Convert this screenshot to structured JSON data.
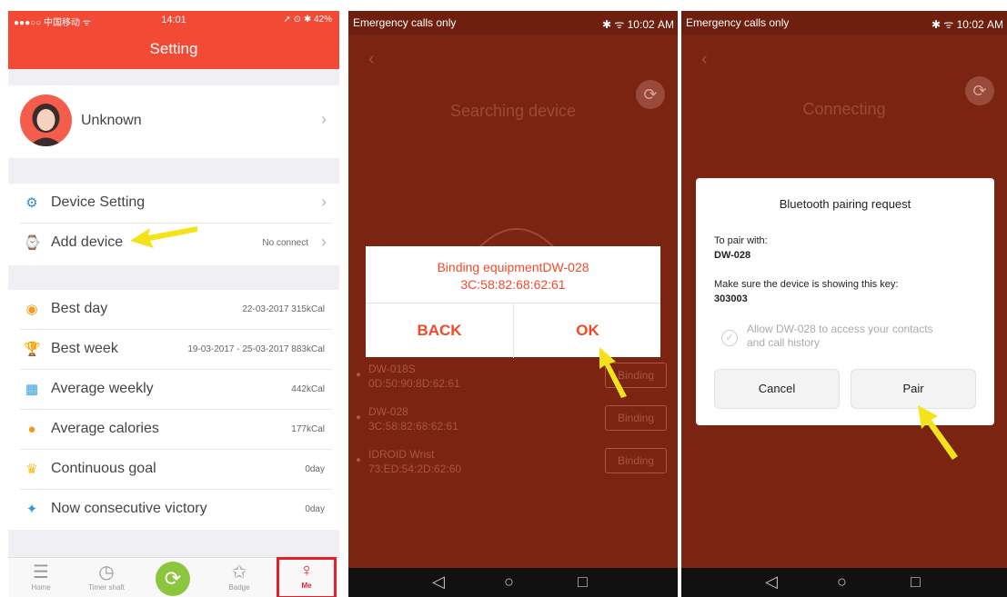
{
  "ios": {
    "status": {
      "carrier": "●●●○○ 中国移动 ᯤ",
      "time": "14:01",
      "right": "➚ ⊙ ✱ 42%"
    },
    "nav_title": "Setting",
    "profile": {
      "name": "Unknown"
    },
    "device_section": [
      {
        "label": "Device Setting",
        "value": ""
      },
      {
        "label": "Add device",
        "value": "No connect"
      }
    ],
    "stats": [
      {
        "label": "Best day",
        "value": "22-03-2017  315kCal"
      },
      {
        "label": "Best week",
        "value": "19-03-2017 - 25-03-2017  883kCal"
      },
      {
        "label": "Average weekly",
        "value": "442kCal"
      },
      {
        "label": "Average calories",
        "value": "177kCal"
      },
      {
        "label": "Continuous goal",
        "value": "0day"
      },
      {
        "label": "Now consecutive victory",
        "value": "0day"
      }
    ],
    "tabs": {
      "home": "Home",
      "timer": "Timer shaft",
      "badge": "Badge",
      "me": "Me"
    }
  },
  "search": {
    "status_left": "Emergency calls only",
    "status_right": "✱ ᯤ 10:02 AM",
    "title": "Searching device",
    "devices": [
      {
        "name": "DW-018S",
        "mac": "0D:50:90:8D:62:61",
        "button": "Binding"
      },
      {
        "name": "DW-028",
        "mac": "3C:58:82:68:62:61",
        "button": "Binding"
      },
      {
        "name": "IDROID Wrist",
        "mac": "73:ED:54:2D:62:60",
        "button": "Binding"
      }
    ],
    "dialog": {
      "line1": "Binding equipmentDW-028",
      "line2": "3C:58:82:68:62:61",
      "back": "BACK",
      "ok": "OK"
    }
  },
  "connect": {
    "status_left": "Emergency calls only",
    "status_right": "✱ ᯤ 10:02 AM",
    "title": "Connecting",
    "dialog": {
      "title": "Bluetooth pairing request",
      "pair_with_label": "To pair with:",
      "device": "DW-028",
      "key_label": "Make sure the device is showing this key:",
      "key": "303003",
      "allow_line1": "Allow DW-028 to access your contacts",
      "allow_line2": "and call history",
      "cancel": "Cancel",
      "pair": "Pair"
    }
  },
  "colors": {
    "accent": "#f24a35",
    "android_bg": "#7a2411",
    "highlight_yellow": "#f5e31a",
    "me_highlight": "#e0202a"
  }
}
